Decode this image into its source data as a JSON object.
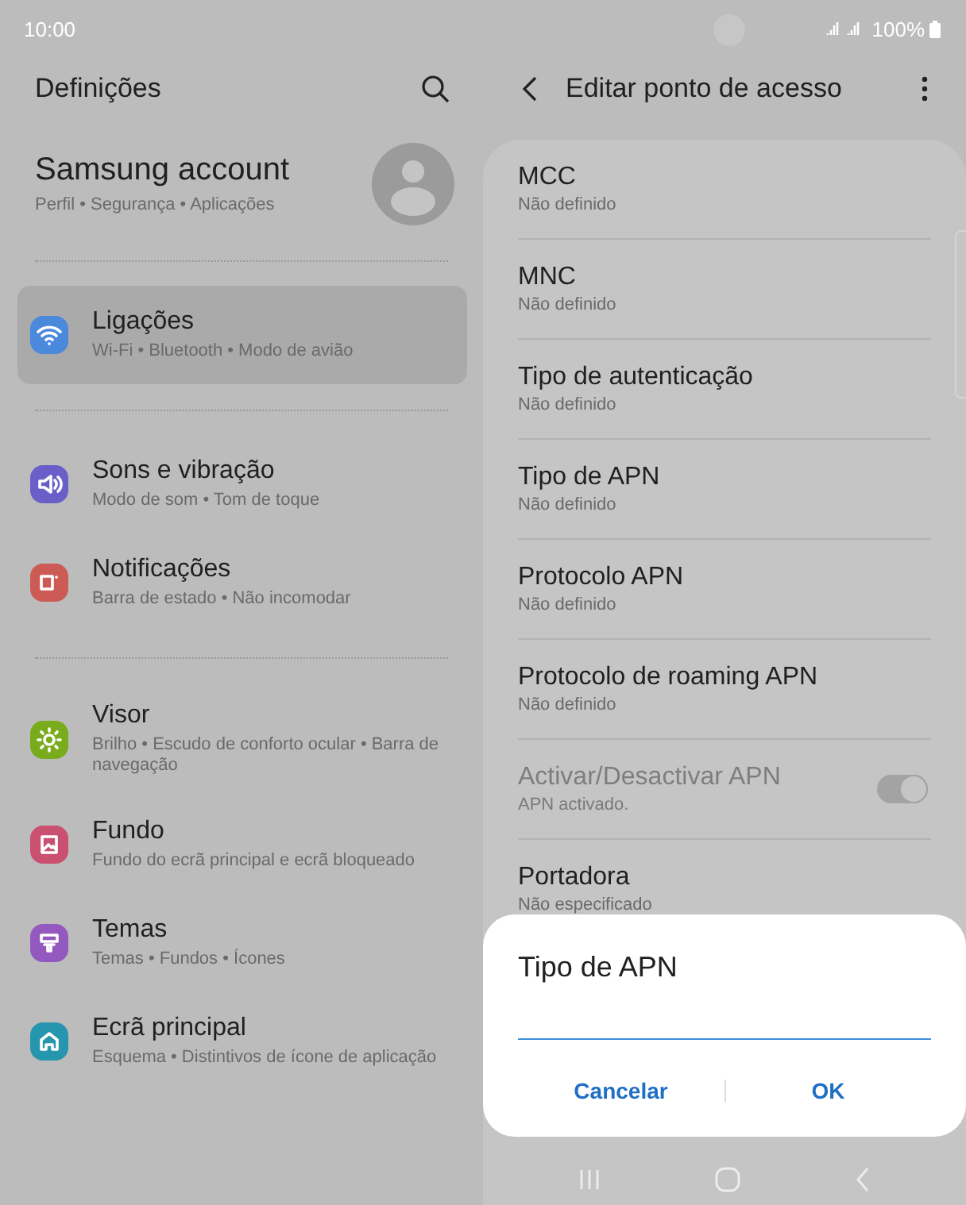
{
  "status_bar": {
    "time": "10:00",
    "battery": "100%"
  },
  "settings": {
    "title": "Definições",
    "account": {
      "name": "Samsung account",
      "subtitle": "Perfil • Segurança • Aplicações"
    },
    "groups": [
      [
        {
          "title": "Ligações",
          "subtitle": "Wi-Fi • Bluetooth • Modo de avião",
          "color": "#4a89dc",
          "selected": true
        }
      ],
      [
        {
          "title": "Sons e vibração",
          "subtitle": "Modo de som • Tom de toque",
          "color": "#6a5fc8",
          "selected": false
        },
        {
          "title": "Notificações",
          "subtitle": "Barra de estado • Não incomodar",
          "color": "#cc5b55",
          "selected": false
        }
      ],
      [
        {
          "title": "Visor",
          "subtitle": "Brilho • Escudo de conforto ocular • Barra de navegação",
          "color": "#79ac1c",
          "selected": false
        },
        {
          "title": "Fundo",
          "subtitle": "Fundo do ecrã principal e ecrã bloqueado",
          "color": "#c9506f",
          "selected": false
        },
        {
          "title": "Temas",
          "subtitle": "Temas • Fundos • Ícones",
          "color": "#9459bf",
          "selected": false
        },
        {
          "title": "Ecrã principal",
          "subtitle": "Esquema • Distintivos de ícone de aplicação",
          "color": "#2596ad",
          "selected": false
        }
      ]
    ]
  },
  "apn": {
    "title": "Editar ponto de acesso",
    "rows": [
      {
        "kind": "value",
        "title": "MCC",
        "subtitle": "Não definido",
        "disabled": false
      },
      {
        "kind": "value",
        "title": "MNC",
        "subtitle": "Não definido",
        "disabled": false
      },
      {
        "kind": "value",
        "title": "Tipo de autenticação",
        "subtitle": "Não definido",
        "disabled": false
      },
      {
        "kind": "value",
        "title": "Tipo de APN",
        "subtitle": "Não definido",
        "disabled": false
      },
      {
        "kind": "value",
        "title": "Protocolo APN",
        "subtitle": "Não definido",
        "disabled": false
      },
      {
        "kind": "value",
        "title": "Protocolo de roaming APN",
        "subtitle": "Não definido",
        "disabled": false
      },
      {
        "kind": "toggle",
        "title": "Activar/Desactivar APN",
        "subtitle": "APN activado.",
        "disabled": true,
        "on": true
      },
      {
        "kind": "value",
        "title": "Portadora",
        "subtitle": "Não especificado",
        "disabled": false
      }
    ]
  },
  "dialog": {
    "title": "Tipo de APN",
    "buttons": [
      "Cancelar",
      "OK"
    ]
  }
}
